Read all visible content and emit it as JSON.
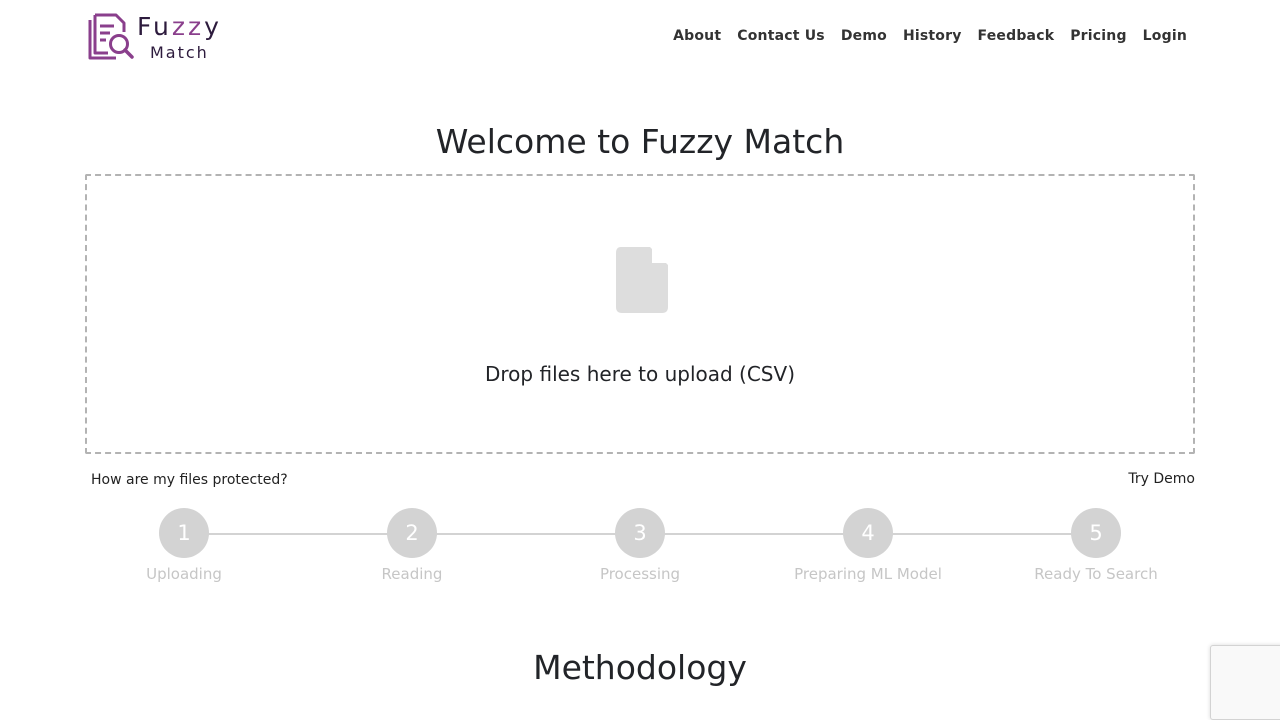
{
  "logo": {
    "word_start": "Fu",
    "word_zz": "zz",
    "word_end": "y",
    "sub": "Match",
    "icon": "document-search-icon",
    "brand_color": "#8a3f8c"
  },
  "nav": {
    "items": [
      "About",
      "Contact Us",
      "Demo",
      "History",
      "Feedback",
      "Pricing",
      "Login"
    ]
  },
  "main": {
    "title": "Welcome to Fuzzy Match",
    "dropzone": {
      "icon": "file-icon",
      "text": "Drop files here to upload (CSV)"
    },
    "protect_link": "How are my files protected?",
    "try_demo": "Try Demo",
    "steps": [
      {
        "number": "1",
        "label": "Uploading"
      },
      {
        "number": "2",
        "label": "Reading"
      },
      {
        "number": "3",
        "label": "Processing"
      },
      {
        "number": "4",
        "label": "Preparing ML Model"
      },
      {
        "number": "5",
        "label": "Ready To Search"
      }
    ],
    "methodology_title": "Methodology"
  }
}
